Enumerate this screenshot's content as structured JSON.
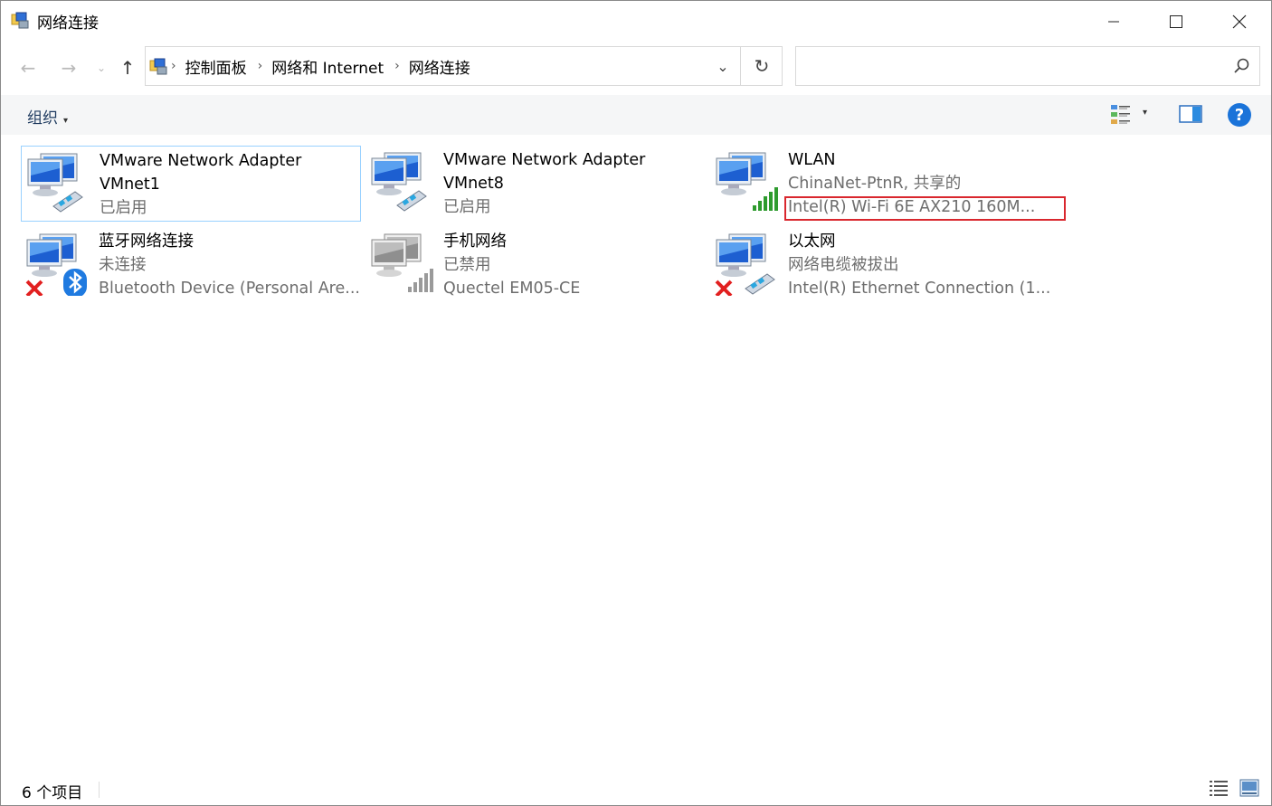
{
  "window": {
    "title": "网络连接",
    "minimize_symbol": "—",
    "maximize_symbol": "☐",
    "close_symbol": "✕"
  },
  "nav": {
    "back_symbol": "←",
    "forward_symbol": "→",
    "recent_symbol": "⌄",
    "up_symbol": "↑"
  },
  "address": {
    "breadcrumbs": [
      "控制面板",
      "网络和 Internet",
      "网络连接"
    ],
    "separator": "›",
    "dropdown_symbol": "⌄",
    "refresh_symbol": "↻"
  },
  "search": {
    "placeholder": "",
    "value": ""
  },
  "toolbar": {
    "organize_label": "组织",
    "caret": "▾",
    "help_label": "?"
  },
  "connections": [
    {
      "name_line1": "VMware Network Adapter",
      "name_line2": "VMnet1",
      "status": "已启用",
      "device": "",
      "icon": "vmware-adapter-icon",
      "selected": true
    },
    {
      "name_line1": "VMware Network Adapter",
      "name_line2": "VMnet8",
      "status": "已启用",
      "device": "",
      "icon": "vmware-adapter-icon",
      "selected": false
    },
    {
      "name_line1": "WLAN",
      "name_line2": "",
      "status": "ChinaNet-PtnR, 共享的",
      "device": "Intel(R) Wi-Fi 6E AX210 160M...",
      "icon": "wifi-adapter-icon",
      "selected": false
    },
    {
      "name_line1": "蓝牙网络连接",
      "name_line2": "",
      "status": "未连接",
      "device": "Bluetooth Device (Personal Are...",
      "icon": "bluetooth-adapter-icon",
      "selected": false
    },
    {
      "name_line1": "手机网络",
      "name_line2": "",
      "status": "已禁用",
      "device": "Quectel EM05-CE",
      "icon": "cellular-adapter-icon",
      "selected": false
    },
    {
      "name_line1": "以太网",
      "name_line2": "",
      "status": "网络电缆被拔出",
      "device": "Intel(R) Ethernet Connection (1...",
      "icon": "ethernet-adapter-icon",
      "selected": false
    }
  ],
  "statusbar": {
    "item_count": "6 个项目"
  },
  "colors": {
    "accent": "#1a73d9",
    "selection_border": "#99d1ff",
    "highlight_border": "#d9272e",
    "signal_green": "#2e9b2e",
    "disconnect_red": "#e22020"
  }
}
